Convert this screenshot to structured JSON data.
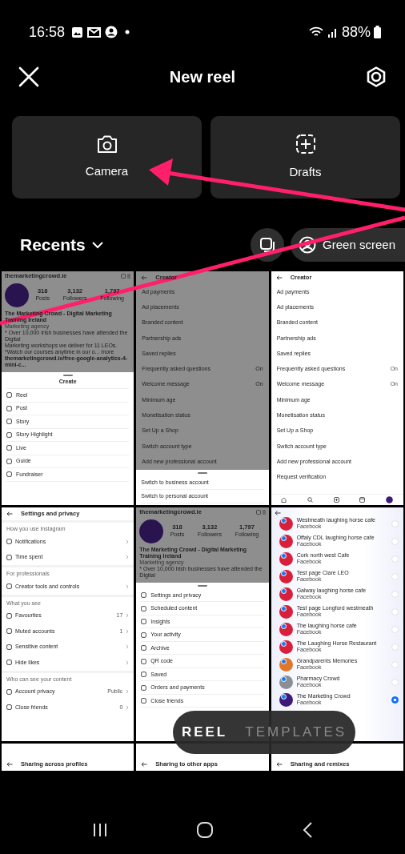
{
  "status_bar": {
    "time": "16:58",
    "battery": "88%"
  },
  "header": {
    "title": "New reel"
  },
  "tiles": [
    {
      "label": "Camera",
      "kind": "camera"
    },
    {
      "label": "Drafts",
      "kind": "drafts"
    }
  ],
  "recents": {
    "label": "Recents",
    "green_screen": "Green screen"
  },
  "gallery": [
    {
      "kind": "profile",
      "dimmed": true,
      "profile": {
        "username": "themarketingcrowd.ie",
        "stats": [
          {
            "value": "318",
            "label": "Posts"
          },
          {
            "value": "3,132",
            "label": "Followers"
          },
          {
            "value": "1,797",
            "label": "Following"
          }
        ],
        "name": "The Marketing Crowd - Digital Marketing Training Ireland",
        "category": "Marketing agency",
        "bio": [
          "* Over 10,000 Irish businesses have attended the Digital",
          "Marketing workshops we deliver for 11 LEOs.",
          "*Watch our courses anytime in our o... more"
        ],
        "link": "themarketingcrowd.ie/free-google-analytics-4-mini-c..."
      },
      "sheet": {
        "title": "Create",
        "items": [
          "Reel",
          "Post",
          "Story",
          "Story Highlight",
          "Live",
          "Guide",
          "Fundraiser"
        ]
      }
    },
    {
      "kind": "settings",
      "dimmed": true,
      "title": "Creator",
      "items": [
        {
          "label": "Ad payments"
        },
        {
          "label": "Ad placements"
        },
        {
          "label": "Branded content"
        },
        {
          "label": "Partnership ads"
        },
        {
          "label": "Saved replies"
        },
        {
          "label": "Frequently asked questions",
          "value": "On"
        },
        {
          "label": "Welcome message",
          "value": "On"
        },
        {
          "label": "Minimum age"
        },
        {
          "label": "Monetisation status"
        },
        {
          "label": "Set Up a Shop"
        },
        {
          "label": "Switch account type"
        },
        {
          "label": "Add new professional account"
        }
      ],
      "sheet": {
        "items": [
          "Switch to business account",
          "Switch to personal account"
        ]
      }
    },
    {
      "kind": "settings",
      "dimmed": false,
      "tab_bar": true,
      "title": "Creator",
      "items": [
        {
          "label": "Ad payments"
        },
        {
          "label": "Ad placements"
        },
        {
          "label": "Branded content"
        },
        {
          "label": "Partnership ads"
        },
        {
          "label": "Saved replies"
        },
        {
          "label": "Frequently asked questions",
          "value": "On"
        },
        {
          "label": "Welcome message",
          "value": "On"
        },
        {
          "label": "Minimum age"
        },
        {
          "label": "Monetisation status"
        },
        {
          "label": "Set Up a Shop"
        },
        {
          "label": "Switch account type"
        },
        {
          "label": "Add new professional account"
        },
        {
          "label": "Request verification"
        }
      ]
    },
    {
      "kind": "sections",
      "title": "Settings and privacy",
      "sections": [
        {
          "title": "How you use Instagram",
          "items": [
            {
              "label": "Notifications"
            },
            {
              "label": "Time spent"
            }
          ]
        },
        {
          "title": "For professionals",
          "items": [
            {
              "label": "Creator tools and controls"
            }
          ]
        },
        {
          "title": "What you see",
          "items": [
            {
              "label": "Favourites",
              "value": "17"
            },
            {
              "label": "Muted accounts",
              "value": "1"
            },
            {
              "label": "Sensitive content"
            },
            {
              "label": "Hide likes"
            }
          ]
        },
        {
          "title": "Who can see your content",
          "items": [
            {
              "label": "Account privacy",
              "value": "Public"
            },
            {
              "label": "Close friends",
              "value": "0"
            }
          ]
        }
      ]
    },
    {
      "kind": "profile",
      "dimmed": true,
      "profile": {
        "username": "themarketingcrowd.ie",
        "stats": [
          {
            "value": "318",
            "label": "Posts"
          },
          {
            "value": "3,132",
            "label": "Followers"
          },
          {
            "value": "1,797",
            "label": "Following"
          }
        ],
        "name": "The Marketing Crowd - Digital Marketing Training Ireland",
        "category": "Marketing agency",
        "bio": [
          "* Over 10,000 Irish businesses have attended the Digital"
        ]
      },
      "sheet": {
        "items": [
          "Settings and privacy",
          "Scheduled content",
          "Insights",
          "Your activity",
          "Archive",
          "QR code",
          "Saved",
          "Orders and payments",
          "Close friends"
        ]
      }
    },
    {
      "kind": "accounts",
      "accounts": [
        {
          "name": "Westmeath laughing horse cafe",
          "source": "Facebook",
          "color": "#d81f3c",
          "selected": false
        },
        {
          "name": "Offaly CDL laughing horse cafe",
          "source": "Facebook",
          "color": "#d81f3c",
          "selected": false
        },
        {
          "name": "Cork north west Cafe",
          "source": "Facebook",
          "color": "#d81f3c",
          "selected": false
        },
        {
          "name": "Test page Clare LEO",
          "source": "Facebook",
          "color": "#d81f3c",
          "selected": false
        },
        {
          "name": "Galway laughing horse cafe",
          "source": "Facebook",
          "color": "#d81f3c",
          "selected": false
        },
        {
          "name": "Test page Longford westmeath",
          "source": "Facebook",
          "color": "#d81f3c",
          "selected": false
        },
        {
          "name": "The laughing horse cafe",
          "source": "Facebook",
          "color": "#d81f3c",
          "selected": false
        },
        {
          "name": "The Laughing Horse Restaurant",
          "source": "Facebook",
          "color": "#d81f3c",
          "selected": false
        },
        {
          "name": "Grandparents Memories",
          "source": "Facebook",
          "color": "#e0772a",
          "selected": false
        },
        {
          "name": "Pharmacy Crowd",
          "source": "Facebook",
          "color": "#8a8f96",
          "selected": false
        },
        {
          "name": "The Marketing Crowd",
          "source": "Facebook",
          "color": "#3d1a78",
          "selected": true
        }
      ]
    },
    {
      "kind": "partial",
      "title": "Sharing across profiles"
    },
    {
      "kind": "partial",
      "title": "Sharing to other apps"
    },
    {
      "kind": "partial",
      "title": "Sharing and remixes"
    }
  ],
  "modes": [
    {
      "label": "REEL",
      "selected": true
    },
    {
      "label": "TEMPLATES",
      "selected": false
    }
  ]
}
